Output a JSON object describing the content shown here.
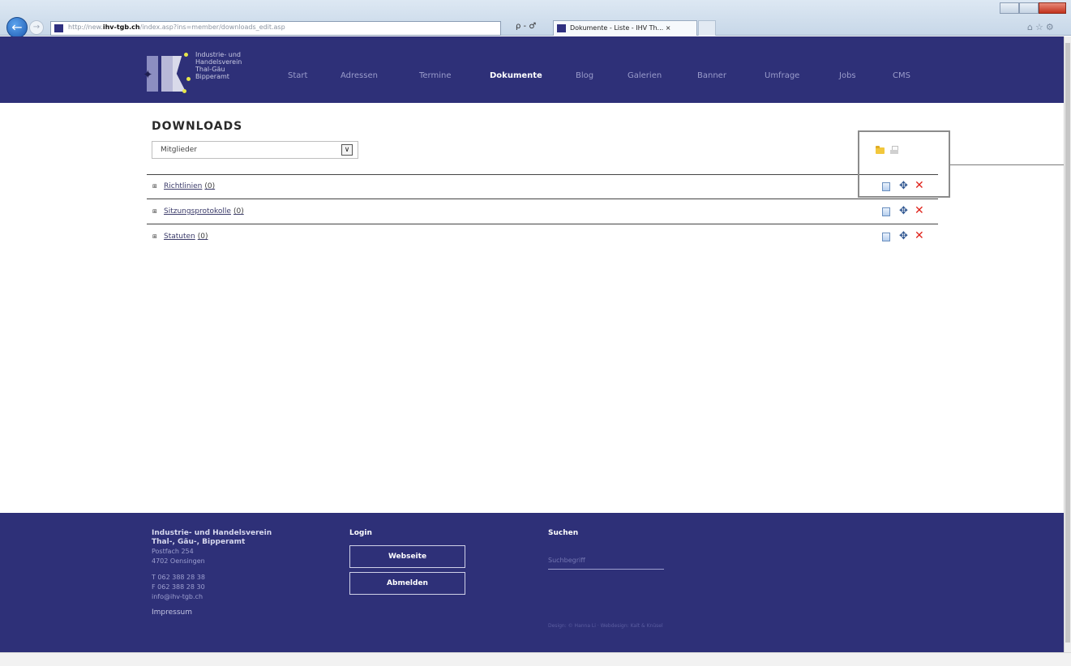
{
  "browser": {
    "address_prefix": "http://new.",
    "address_domain": "ihv-tgb.ch",
    "address_path": "/index.asp?ins=member/downloads_edit.asp",
    "address_tools": "ρ - ♂",
    "tab_title": "Dokumente - Liste - IHV Th... ×"
  },
  "header": {
    "logo_text": [
      "Industrie- und",
      "Handelsverein",
      "Thal-Gäu",
      "Bipperamt"
    ],
    "nav": [
      {
        "label": "Start",
        "active": false
      },
      {
        "label": "Adressen",
        "active": false
      },
      {
        "label": "Termine",
        "active": false
      },
      {
        "label": "Dokumente",
        "active": true
      },
      {
        "label": "Blog",
        "active": false
      },
      {
        "label": "Galerien",
        "active": false
      },
      {
        "label": "Banner",
        "active": false
      },
      {
        "label": "Umfrage",
        "active": false
      },
      {
        "label": "Jobs",
        "active": false
      },
      {
        "label": "CMS",
        "active": false
      }
    ]
  },
  "main": {
    "title": "DOWNLOADS",
    "select_value": "Mitglieder",
    "folders": [
      {
        "label": "Richtlinien",
        "count": "(0)"
      },
      {
        "label": "Sitzungsprotokolle",
        "count": "(0)"
      },
      {
        "label": "Statuten",
        "count": "(0)"
      }
    ]
  },
  "footer": {
    "org_line1": "Industrie- und Handelsverein",
    "org_line2": "Thal-, Gäu-, Bipperamt",
    "address1": "Postfach 254",
    "address2": "4702 Oensingen",
    "phone": "T 062 388 28 38",
    "fax": "F 062 388 28 30",
    "email": "info@ihv-tgb.ch",
    "impressum": "Impressum",
    "login_heading": "Login",
    "website_button": "Webseite",
    "logout_button": "Abmelden",
    "search_heading": "Suchen",
    "search_placeholder": "Suchbegriff",
    "copyright": "Design: © Hanna Li · Webdesign: Kalt & Knüsel"
  },
  "colors": {
    "brand": "#2e3078",
    "link": "#3b3b6a",
    "delete": "#e0241c",
    "highlight_border": "#8c8c8c"
  },
  "icons": [
    "back-arrow-icon",
    "forward-arrow-icon",
    "folder-icon",
    "print-icon",
    "document-icon",
    "move-icon",
    "delete-icon",
    "expand-icon"
  ]
}
